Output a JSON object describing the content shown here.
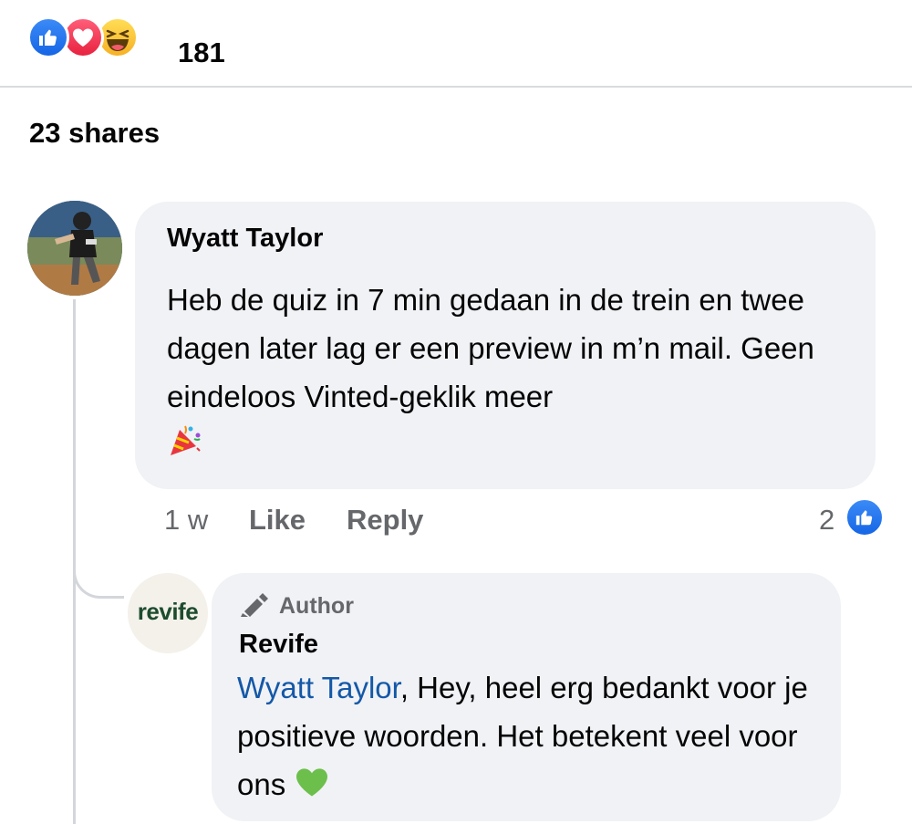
{
  "reactions": {
    "icons": [
      "like-icon",
      "love-icon",
      "haha-icon"
    ],
    "count": "181"
  },
  "shares": "23 shares",
  "comment": {
    "author": "Wyatt Taylor",
    "text": "Heb de quiz in 7 min gedaan in de trein en twee dagen later lag er een preview in m’n mail. Geen eindeloos Vinted-geklik meer",
    "emoji": "party-popper-icon",
    "time": "1 w",
    "like_label": "Like",
    "reply_label": "Reply",
    "like_count": "2"
  },
  "reply": {
    "badge": "Author",
    "author": "Revife",
    "logo_text": "revife",
    "mention": "Wyatt Taylor",
    "text": ", Hey, heel erg bedankt voor je positieve woorden. Het betekent veel voor ons",
    "emoji": "green-heart-icon"
  },
  "colors": {
    "like_blue": "#1877f2",
    "love_red": "#f02849",
    "mention_blue": "#1458a8",
    "bubble_bg": "#f0f2f5",
    "muted_text": "#65676b"
  }
}
